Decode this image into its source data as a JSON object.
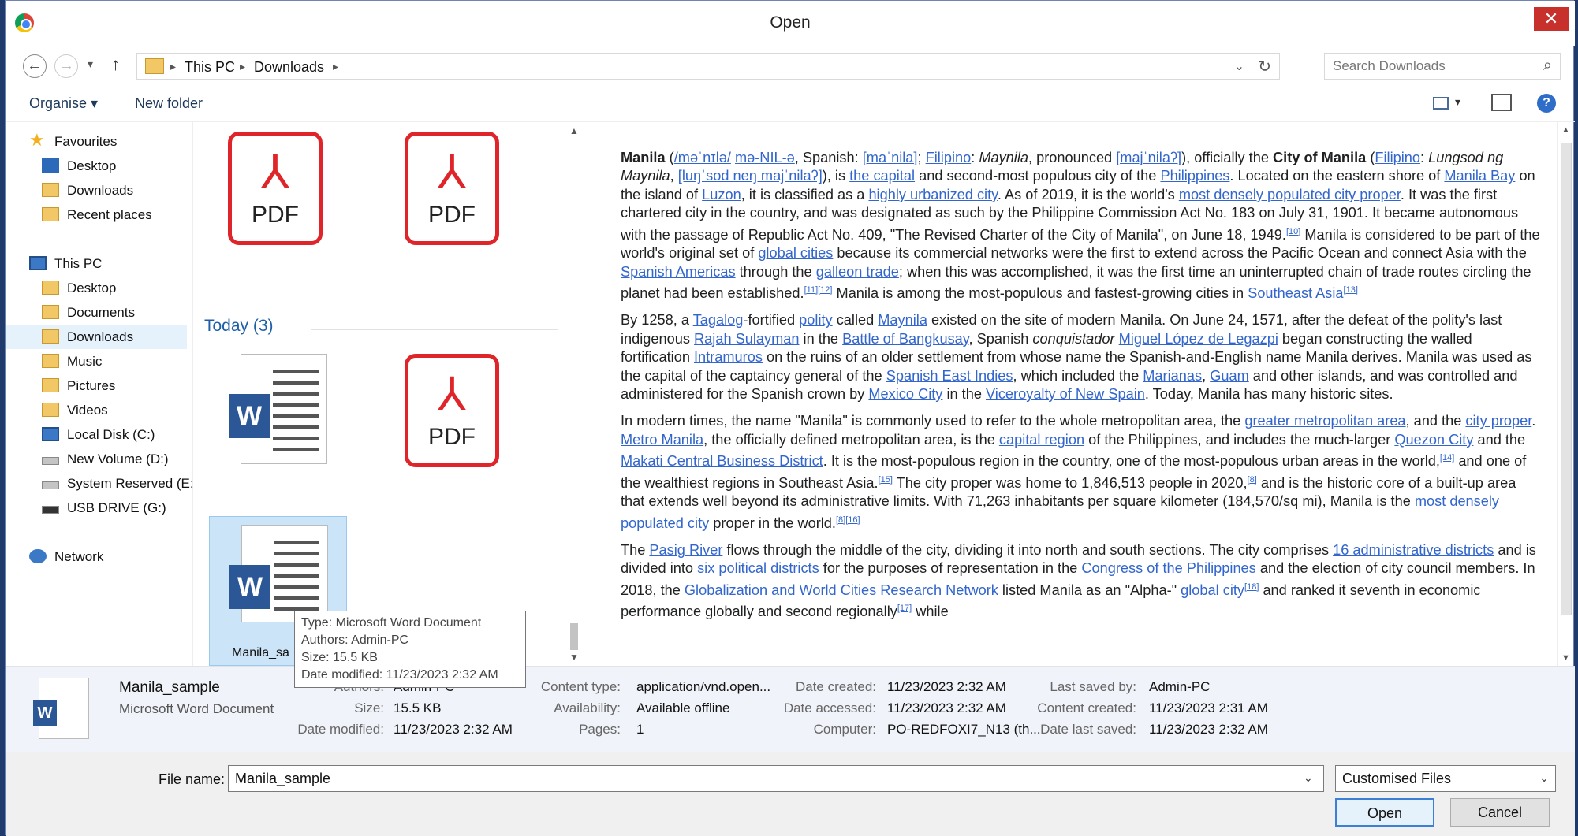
{
  "window": {
    "title": "Open",
    "close": "✕"
  },
  "address": {
    "crumbs": [
      "This PC",
      "Downloads"
    ],
    "separator": "▸",
    "search_placeholder": "Search Downloads"
  },
  "toolbar": {
    "organise": "Organise ▾",
    "new_folder": "New folder"
  },
  "nav": {
    "items": [
      {
        "label": "Favourites"
      },
      {
        "label": "Desktop"
      },
      {
        "label": "Downloads"
      },
      {
        "label": "Recent places"
      },
      {
        "label": "This PC"
      },
      {
        "label": "Desktop"
      },
      {
        "label": "Documents"
      },
      {
        "label": "Downloads"
      },
      {
        "label": "Music"
      },
      {
        "label": "Pictures"
      },
      {
        "label": "Videos"
      },
      {
        "label": "Local Disk (C:)"
      },
      {
        "label": "New Volume (D:)"
      },
      {
        "label": "System Reserved (E:"
      },
      {
        "label": "USB DRIVE (G:)"
      },
      {
        "label": "Network"
      }
    ]
  },
  "files": {
    "group_label": "Today (3)",
    "pdf_text": "PDF",
    "pdf_mark": "⅄",
    "word_letter": "W",
    "selected_name": "Manila_sa"
  },
  "tooltip": {
    "type": "Type: Microsoft Word Document",
    "authors": "Authors: Admin-PC",
    "size": "Size: 15.5 KB",
    "modified": "Date modified: 11/23/2023 2:32 AM"
  },
  "details": {
    "name": "Manila_sample",
    "type": "Microsoft Word Document",
    "authors_k": "Authors:",
    "authors_v": "Admin-PC",
    "size_k": "Size:",
    "size_v": "15.5 KB",
    "modified_k": "Date modified:",
    "modified_v": "11/23/2023 2:32 AM",
    "content_type_k": "Content type:",
    "content_type_v": "application/vnd.open...",
    "availability_k": "Availability:",
    "availability_v": "Available offline",
    "pages_k": "Pages:",
    "pages_v": "1",
    "created_k": "Date created:",
    "created_v": "11/23/2023 2:32 AM",
    "accessed_k": "Date accessed:",
    "accessed_v": "11/23/2023 2:32 AM",
    "computer_k": "Computer:",
    "computer_v": "PO-REDFOXI7_N13 (th...",
    "saved_by_k": "Last saved by:",
    "saved_by_v": "Admin-PC",
    "content_created_k": "Content created:",
    "content_created_v": "11/23/2023 2:31 AM",
    "last_saved_k": "Date last saved:",
    "last_saved_v": "11/23/2023 2:32 AM"
  },
  "bottom": {
    "file_name_label": "File name:",
    "file_name_value": "Manila_sample",
    "filter": "Customised Files",
    "open": "Open",
    "cancel": "Cancel"
  },
  "preview": {
    "p1": [
      [
        "b",
        "Manila"
      ],
      [
        "t",
        " ("
      ],
      [
        "a",
        "/məˈnɪlə/"
      ],
      [
        "t",
        " "
      ],
      [
        "a",
        "mə-NIL-ə"
      ],
      [
        "t",
        ", Spanish: "
      ],
      [
        "a",
        "[maˈnila]"
      ],
      [
        "t",
        "; "
      ],
      [
        "a",
        "Filipino"
      ],
      [
        "t",
        ": "
      ],
      [
        "i",
        "Maynila"
      ],
      [
        "t",
        ", pronounced "
      ],
      [
        "a",
        "[majˈnilaʔ]"
      ],
      [
        "t",
        "), officially the "
      ],
      [
        "b",
        "City of Manila"
      ],
      [
        "t",
        " ("
      ],
      [
        "a",
        "Filipino"
      ],
      [
        "t",
        ": "
      ],
      [
        "i",
        "Lungsod ng Maynila"
      ],
      [
        "t",
        ", "
      ],
      [
        "a",
        "[luŋˈsod neŋ majˈnilaʔ]"
      ],
      [
        "t",
        "), is "
      ],
      [
        "a",
        "the capital"
      ],
      [
        "t",
        " and second-most populous city of the "
      ],
      [
        "a",
        "Philippines"
      ],
      [
        "t",
        ". Located on the eastern shore of "
      ],
      [
        "a",
        "Manila Bay"
      ],
      [
        "t",
        " on the island of "
      ],
      [
        "a",
        "Luzon"
      ],
      [
        "t",
        ", it is classified as a "
      ],
      [
        "a",
        "highly urbanized city"
      ],
      [
        "t",
        ". As of 2019, it is the world's "
      ],
      [
        "a",
        "most densely populated city proper"
      ],
      [
        "t",
        ". It was the first chartered city in the country, and was designated as such by the Philippine Commission Act No. 183 on July 31, 1901. It became autonomous with the passage of Republic Act No. 409, \"The Revised Charter of the City of Manila\", on June 18, 1949."
      ],
      [
        "s",
        "[10]"
      ],
      [
        "t",
        " Manila is considered to be part of the world's original set of "
      ],
      [
        "a",
        "global cities"
      ],
      [
        "t",
        " because its commercial networks were the first to extend across the Pacific Ocean and connect Asia with the "
      ],
      [
        "a",
        "Spanish Americas"
      ],
      [
        "t",
        " through the "
      ],
      [
        "a",
        "galleon trade"
      ],
      [
        "t",
        "; when this was accomplished, it was the first time an uninterrupted chain of trade routes circling the planet had been established."
      ],
      [
        "s",
        "[11][12]"
      ],
      [
        "t",
        " Manila is among the most-populous and fastest-growing cities in "
      ],
      [
        "a",
        "Southeast Asia"
      ],
      [
        "s",
        "[13]"
      ]
    ],
    "p2": [
      [
        "t",
        "By 1258, a "
      ],
      [
        "a",
        "Tagalog"
      ],
      [
        "t",
        "-fortified "
      ],
      [
        "a",
        "polity"
      ],
      [
        "t",
        " called "
      ],
      [
        "a",
        "Maynila"
      ],
      [
        "t",
        " existed on the site of modern Manila. On June 24, 1571, after the defeat of the polity's last indigenous "
      ],
      [
        "a",
        "Rajah Sulayman"
      ],
      [
        "t",
        " in the "
      ],
      [
        "a",
        "Battle of Bangkusay"
      ],
      [
        "t",
        ", Spanish "
      ],
      [
        "i",
        "conquistador"
      ],
      [
        "t",
        " "
      ],
      [
        "a",
        "Miguel López de Legazpi"
      ],
      [
        "t",
        " began constructing the walled fortification "
      ],
      [
        "a",
        "Intramuros"
      ],
      [
        "t",
        " on the ruins of an older settlement from whose name the Spanish-and-English name Manila derives. Manila was used as the capital of the captaincy general of the "
      ],
      [
        "a",
        "Spanish East Indies"
      ],
      [
        "t",
        ", which included the "
      ],
      [
        "a",
        "Marianas"
      ],
      [
        "t",
        ", "
      ],
      [
        "a",
        "Guam"
      ],
      [
        "t",
        " and other islands, and was controlled and administered for the Spanish crown by "
      ],
      [
        "a",
        "Mexico City"
      ],
      [
        "t",
        " in the "
      ],
      [
        "a",
        "Viceroyalty of New Spain"
      ],
      [
        "t",
        ". Today, Manila has many historic sites."
      ]
    ],
    "p3": [
      [
        "t",
        "In modern times, the name \"Manila\" is commonly used to refer to the whole metropolitan area, the "
      ],
      [
        "a",
        "greater metropolitan area"
      ],
      [
        "t",
        ", and the "
      ],
      [
        "a",
        "city proper"
      ],
      [
        "t",
        ". "
      ],
      [
        "a",
        "Metro Manila"
      ],
      [
        "t",
        ", the officially defined metropolitan area, is the "
      ],
      [
        "a",
        "capital region"
      ],
      [
        "t",
        " of the Philippines, and includes the much-larger "
      ],
      [
        "a",
        "Quezon City"
      ],
      [
        "t",
        " and the "
      ],
      [
        "a",
        "Makati Central Business District"
      ],
      [
        "t",
        ". It is the most-populous region in the country, one of the most-populous urban areas in the world,"
      ],
      [
        "s",
        "[14]"
      ],
      [
        "t",
        " and one of the wealthiest regions in Southeast Asia."
      ],
      [
        "s",
        "[15]"
      ],
      [
        "t",
        " The city proper was home to 1,846,513 people in 2020,"
      ],
      [
        "s",
        "[8]"
      ],
      [
        "t",
        " and is the historic core of a built-up area that extends well beyond its administrative limits. With 71,263 inhabitants per square kilometer (184,570/sq mi), Manila is the "
      ],
      [
        "a",
        "most densely populated city"
      ],
      [
        "t",
        " proper in the world."
      ],
      [
        "s",
        "[8][16]"
      ]
    ],
    "p4": [
      [
        "t",
        "The "
      ],
      [
        "a",
        "Pasig River"
      ],
      [
        "t",
        " flows through the middle of the city, dividing it into north and south sections. The city comprises "
      ],
      [
        "a",
        "16 administrative districts"
      ],
      [
        "t",
        " and is divided into "
      ],
      [
        "a",
        "six political districts"
      ],
      [
        "t",
        " for the purposes of representation in the "
      ],
      [
        "a",
        "Congress of the Philippines"
      ],
      [
        "t",
        " and the election of city council members. In 2018, the "
      ],
      [
        "a",
        "Globalization and World Cities Research Network"
      ],
      [
        "t",
        " listed Manila as an \"Alpha-\" "
      ],
      [
        "a",
        "global city"
      ],
      [
        "s",
        "[18]"
      ],
      [
        "t",
        " and ranked it seventh in economic performance globally and second regionally"
      ],
      [
        "s",
        "[17]"
      ],
      [
        "t",
        " while"
      ]
    ]
  }
}
